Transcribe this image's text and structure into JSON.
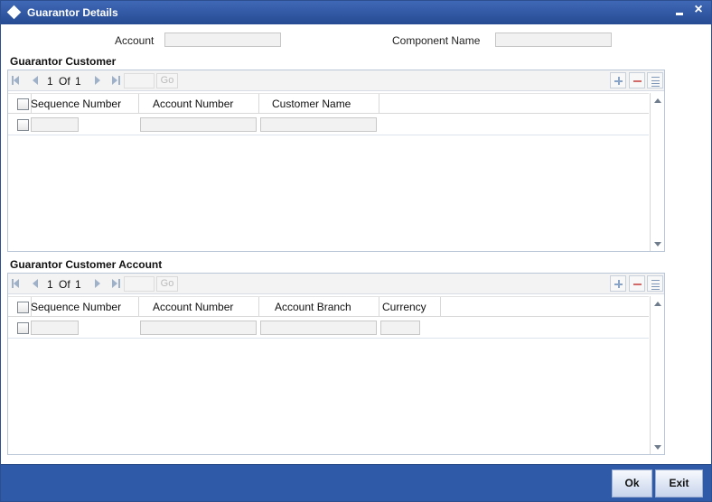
{
  "window": {
    "title": "Guarantor Details",
    "minimize_icon": "minimize-icon",
    "close_icon": "close-icon"
  },
  "form": {
    "account_label": "Account",
    "account_value": "",
    "component_name_label": "Component Name",
    "component_name_value": ""
  },
  "guarantor_customer": {
    "section_title": "Guarantor Customer",
    "pagination": {
      "current_page": "1",
      "of_label": "Of",
      "total_pages": "1",
      "page_input_value": "",
      "go_label": "Go"
    },
    "toolbar_icons": [
      "plus-icon",
      "minus-icon",
      "list-icon"
    ],
    "columns": [
      "Sequence Number",
      "Account Number",
      "Customer Name"
    ],
    "rows": [
      {
        "sequence_number": "",
        "account_number": "",
        "customer_name": ""
      }
    ]
  },
  "guarantor_customer_account": {
    "section_title": "Guarantor Customer Account",
    "pagination": {
      "current_page": "1",
      "of_label": "Of",
      "total_pages": "1",
      "page_input_value": "",
      "go_label": "Go"
    },
    "toolbar_icons": [
      "plus-icon",
      "minus-icon",
      "list-icon"
    ],
    "columns": [
      "Sequence Number",
      "Account Number",
      "Account Branch",
      "Currency"
    ],
    "rows": [
      {
        "sequence_number": "",
        "account_number": "",
        "account_branch": "",
        "currency": ""
      }
    ]
  },
  "footer": {
    "ok_label": "Ok",
    "exit_label": "Exit"
  },
  "colors": {
    "titlebar": "#2f5aa7",
    "footer": "#2f5aa7",
    "border": "#b9c6d8",
    "input_background": "#f2f2f2"
  }
}
